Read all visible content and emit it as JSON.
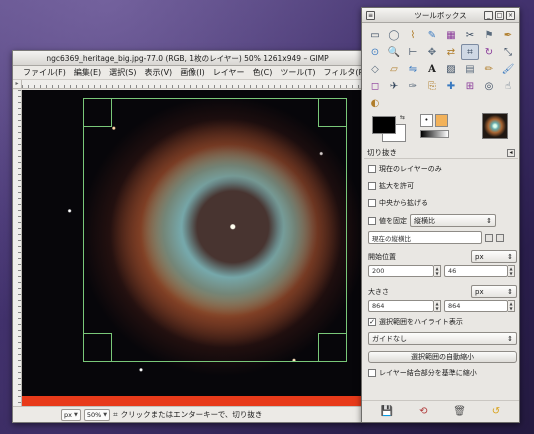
{
  "image_window": {
    "title": "ngc6369_heritage_big.jpg-77.0 (RGB, 1枚のレイヤー) 50% 1261x949 – GIMP",
    "menus": [
      "ファイル(F)",
      "編集(E)",
      "選択(S)",
      "表示(V)",
      "画像(I)",
      "レイヤー",
      "色(C)",
      "ツール(T)",
      "フィルタ(R)"
    ],
    "status": {
      "unit": "px",
      "zoom": "50%",
      "message": "クリックまたはエンターキーで、切り抜き"
    }
  },
  "toolbox": {
    "title": "ツールボックス",
    "tools": [
      {
        "icon": "▭",
        "name": "rect-select-icon"
      },
      {
        "icon": "◯",
        "name": "ellipse-select-icon"
      },
      {
        "icon": "⌇",
        "name": "free-select-icon"
      },
      {
        "icon": "✎",
        "name": "fuzzy-select-icon"
      },
      {
        "icon": "▦",
        "name": "select-by-color-icon"
      },
      {
        "icon": "✂",
        "name": "scissors-icon"
      },
      {
        "icon": "⚑",
        "name": "foreground-select-icon"
      },
      {
        "icon": "✒",
        "name": "paths-icon"
      },
      {
        "icon": "⊙",
        "name": "color-picker-icon"
      },
      {
        "icon": "🔍",
        "name": "zoom-icon"
      },
      {
        "icon": "⊢",
        "name": "measure-icon"
      },
      {
        "icon": "✥",
        "name": "move-icon"
      },
      {
        "icon": "⇄",
        "name": "align-icon"
      },
      {
        "icon": "⌗",
        "name": "crop-icon"
      },
      {
        "icon": "↻",
        "name": "rotate-icon"
      },
      {
        "icon": "⤡",
        "name": "scale-icon"
      },
      {
        "icon": "◇",
        "name": "shear-icon"
      },
      {
        "icon": "▱",
        "name": "perspective-icon"
      },
      {
        "icon": "⇋",
        "name": "flip-icon"
      },
      {
        "icon": "A",
        "name": "text-icon"
      },
      {
        "icon": "▨",
        "name": "bucket-fill-icon"
      },
      {
        "icon": "▤",
        "name": "blend-icon"
      },
      {
        "icon": "✏",
        "name": "pencil-icon"
      },
      {
        "icon": "🖌",
        "name": "paintbrush-icon"
      },
      {
        "icon": "◻",
        "name": "eraser-icon"
      },
      {
        "icon": "✈",
        "name": "airbrush-icon"
      },
      {
        "icon": "✑",
        "name": "ink-icon"
      },
      {
        "icon": "⎘",
        "name": "clone-icon"
      },
      {
        "icon": "✚",
        "name": "heal-icon"
      },
      {
        "icon": "⊞",
        "name": "perspective-clone-icon"
      },
      {
        "icon": "◎",
        "name": "blur-icon"
      },
      {
        "icon": "☝",
        "name": "smudge-icon"
      },
      {
        "icon": "◐",
        "name": "dodge-burn-icon"
      }
    ],
    "options": {
      "header": "切り抜き",
      "current_layer_only": "現在のレイヤーのみ",
      "allow_growing": "拡大を許可",
      "expand_from_center": "中央から拡げる",
      "fixed_label": "値を固定",
      "fixed_value": "縦横比",
      "current_ratio": "現在の縦横比",
      "position_label": "開始位置",
      "position_unit": "px",
      "position_x": "200",
      "position_y": "46",
      "size_label": "大きさ",
      "size_unit": "px",
      "size_w": "864",
      "size_h": "864",
      "highlight_label": "選択範囲をハイライト表示",
      "guides_value": "ガイドなし",
      "autoshrink_label": "選択範囲の自動縮小",
      "shrink_merged_label": "レイヤー結合部分を基準に縮小"
    }
  }
}
